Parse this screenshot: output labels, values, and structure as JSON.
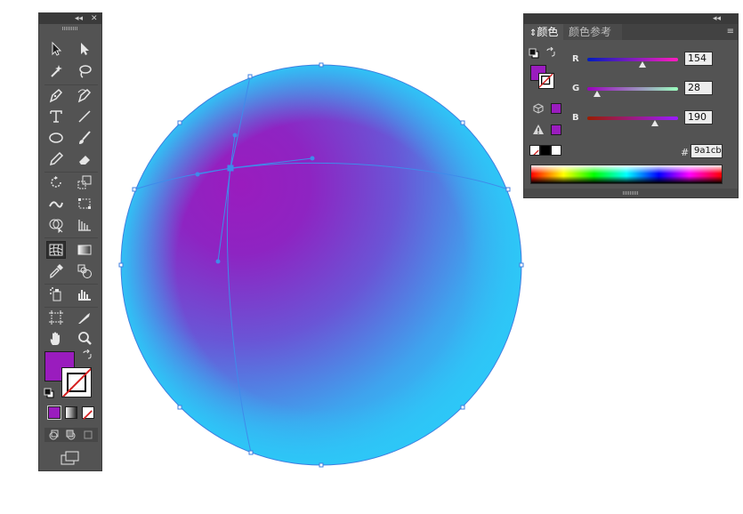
{
  "app": {
    "brand_purple": "#9a1cbe",
    "canvas_background": "#ffffff"
  },
  "tools_panel": {
    "collapse_glyph": "◂◂",
    "close_glyph": "✕",
    "tools": [
      "selection-tool",
      "direct-selection-tool",
      "magic-wand-tool",
      "lasso-tool",
      "pen-tool",
      "curvature-pen-tool",
      "type-tool",
      "line-segment-tool",
      "ellipse-tool",
      "paintbrush-tool",
      "pencil-tool",
      "eraser-tool",
      "rotate-tool",
      "scale-tool",
      "width-tool",
      "free-transform-tool",
      "shape-builder-tool",
      "perspective-grid-tool",
      "mesh-tool",
      "gradient-tool",
      "eyedropper-tool",
      "blend-tool",
      "symbol-sprayer-tool",
      "column-graph-tool",
      "artboard-tool",
      "slice-tool",
      "hand-tool",
      "zoom-tool"
    ],
    "active_tool": "mesh-tool",
    "fill_color": "#9a1cbe",
    "stroke": "none"
  },
  "canvas": {
    "object": "mesh-circle",
    "colors": {
      "outer": "#2fc6f6",
      "center": "#9a1cbe",
      "mid": "#6a55d6"
    }
  },
  "color_panel": {
    "collapse_glyph": "◂◂",
    "tabs": [
      {
        "label": "颜色",
        "active": true
      },
      {
        "label": "颜色参考",
        "active": false
      }
    ],
    "tab_arrow": "⇕",
    "menu_glyph": "≡",
    "sliders": [
      {
        "label": "R",
        "value": "154",
        "fraction": 0.604,
        "gradient": [
          "#001cbe",
          "#ff1cbe"
        ]
      },
      {
        "label": "G",
        "value": "28",
        "fraction": 0.11,
        "gradient": [
          "#9a00be",
          "#9affbe"
        ]
      },
      {
        "label": "B",
        "value": "190",
        "fraction": 0.745,
        "gradient": [
          "#9a1c00",
          "#9a1cff"
        ]
      }
    ],
    "hex_label": "#",
    "hex_value": "9a1cb",
    "fill_color": "#9a1cbe"
  }
}
